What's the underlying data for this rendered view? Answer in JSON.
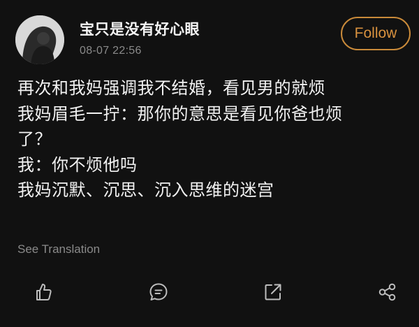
{
  "post": {
    "author": "宝只是没有好心眼",
    "timestamp": "08-07 22:56",
    "follow_label": "Follow",
    "lines": [
      "再次和我妈强调我不结婚，看见男的就烦",
      "我妈眉毛一拧：那你的意思是看见你爸也烦",
      "了？",
      "我：你不烦他吗",
      "我妈沉默、沉思、沉入思维的迷宫"
    ],
    "see_translation": "See Translation"
  },
  "actions": [
    {
      "name": "like",
      "icon": "thumbs-up-icon"
    },
    {
      "name": "comment",
      "icon": "comment-icon"
    },
    {
      "name": "repost",
      "icon": "external-share-icon"
    },
    {
      "name": "share",
      "icon": "share-nodes-icon"
    }
  ],
  "colors": {
    "background": "#111111",
    "text": "#f2f2f2",
    "muted": "#8a8a8a",
    "accent": "#d9923f"
  }
}
